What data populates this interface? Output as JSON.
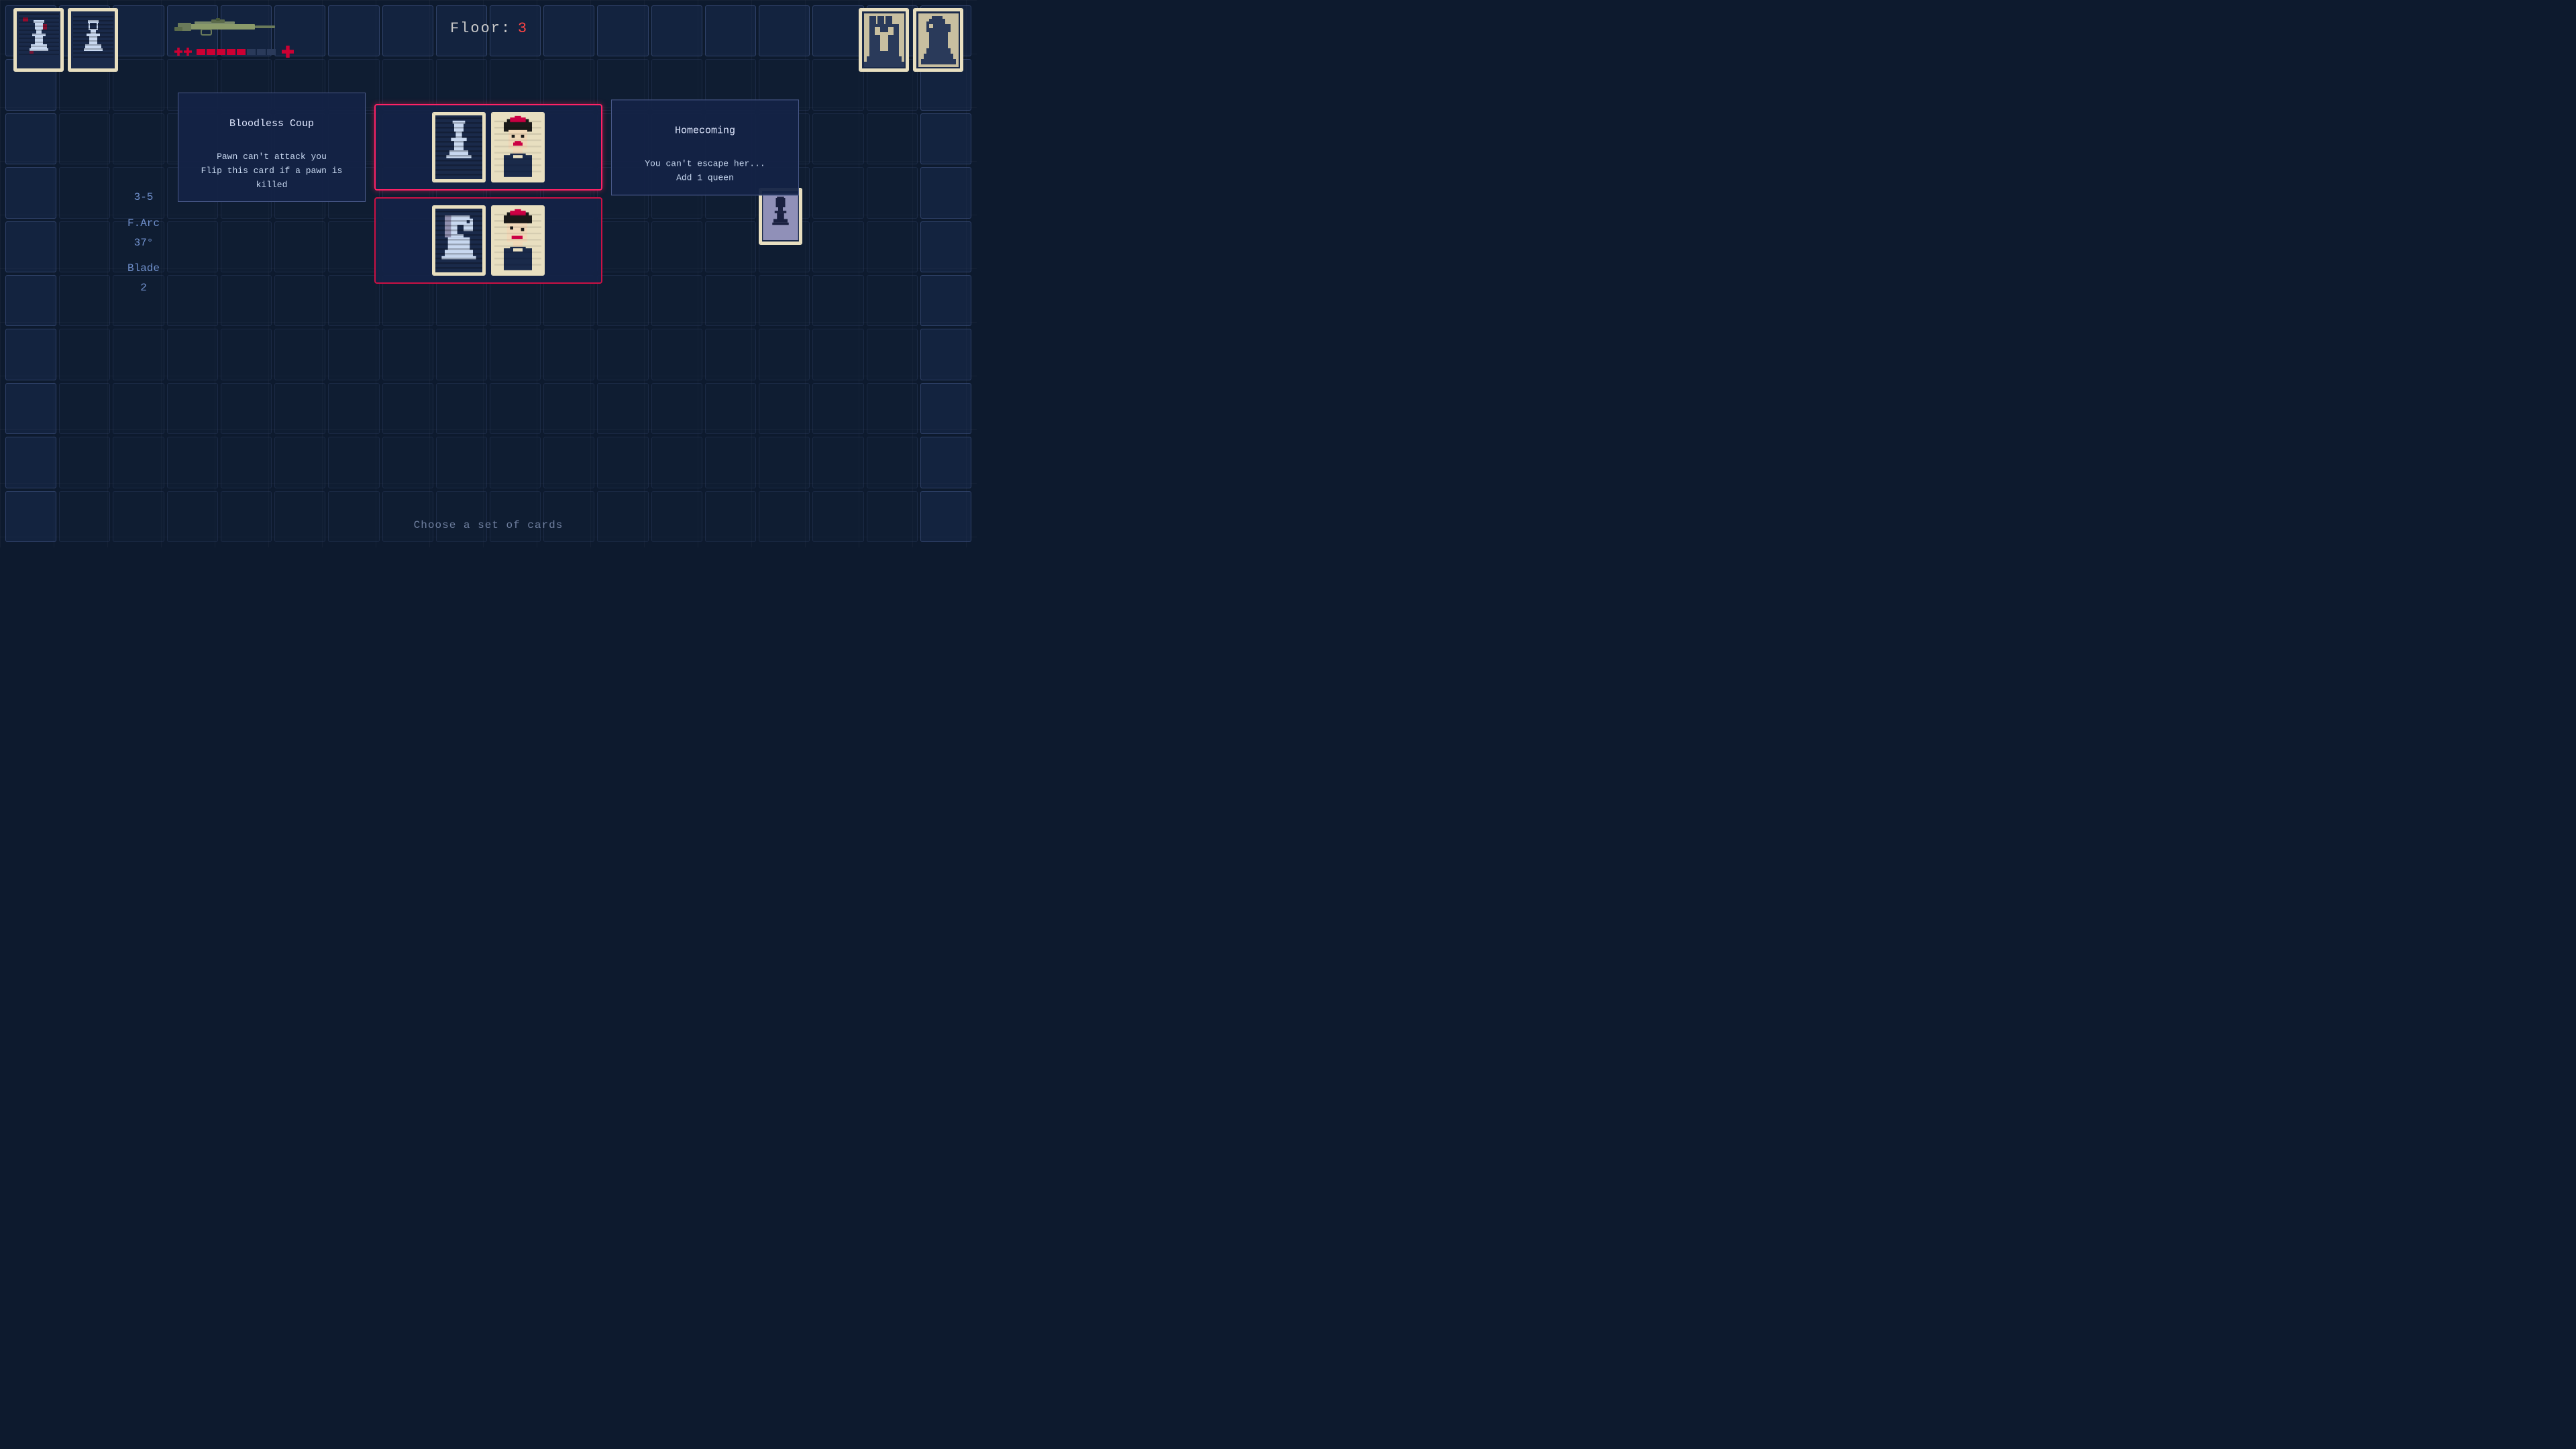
{
  "hud": {
    "floor_label": "Floor:",
    "floor_number": "3",
    "weapon": {
      "ammo_filled": 5,
      "ammo_total": 8,
      "has_health": true
    }
  },
  "stats": {
    "range_label": "3-5",
    "arc_label": "F.Arc",
    "arc_value": "37°",
    "blade_label": "Blade",
    "blade_value": "2"
  },
  "option_sets": [
    {
      "id": "set-1",
      "selected": true,
      "cards": [
        {
          "id": "card-pawn",
          "type": "pawn",
          "alt": "Pawn chess piece card"
        },
        {
          "id": "card-queen-1",
          "type": "queen",
          "alt": "Queen chess piece card"
        }
      ],
      "tooltip_left": {
        "title": "Bloodless Coup",
        "lines": "Pawn can't attack you\nFlip this card if a pawn is\nkilled"
      },
      "tooltip_right": {
        "title": "Homecoming",
        "lines": "You can't escape her...\nAdd 1 queen"
      }
    },
    {
      "id": "set-2",
      "selected": false,
      "cards": [
        {
          "id": "card-knight",
          "type": "knight",
          "alt": "Knight chess piece card"
        },
        {
          "id": "card-queen-2",
          "type": "queen",
          "alt": "Queen chess piece card"
        }
      ]
    }
  ],
  "bottom_prompt": "Choose a set of cards",
  "player_cards": [
    {
      "id": "player-card-1",
      "type": "pawn-player"
    },
    {
      "id": "player-card-2",
      "type": "pawn-player-2"
    }
  ],
  "enemy_cards_top_right": [
    {
      "id": "enemy-card-1",
      "type": "tower"
    },
    {
      "id": "enemy-card-2",
      "type": "knight-enemy"
    }
  ],
  "enemy_card_side": {
    "id": "side-enemy-card",
    "type": "pawn-small"
  }
}
